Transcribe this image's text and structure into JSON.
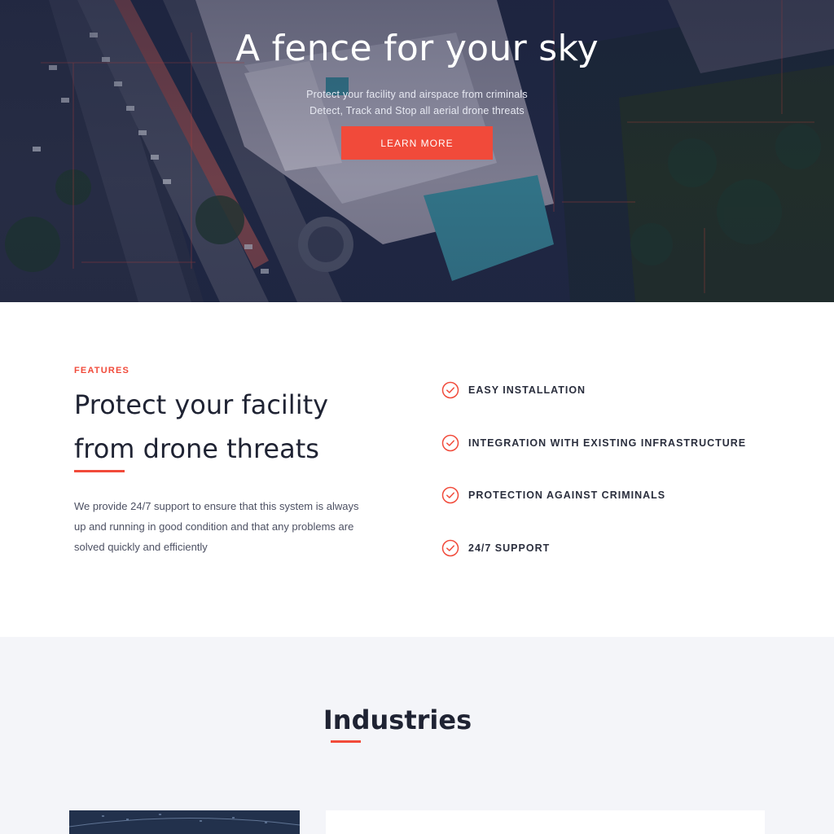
{
  "hero": {
    "title": "A fence for your sky",
    "subtitle_line1": "Protect your facility and airspace from criminals",
    "subtitle_line2": "Detect, Track and Stop all aerial drone threats",
    "cta_label": "LEARN MORE"
  },
  "features": {
    "eyebrow": "FEATURES",
    "title": "Protect your facility from drone threats",
    "description": "We provide 24/7 support to ensure that this system is always up and running in good condition and that any problems are solved quickly and efficiently",
    "items": [
      {
        "label": "EASY INSTALLATION",
        "icon": "check-circle-icon"
      },
      {
        "label": "INTEGRATION WITH EXISTING INFRASTRUCTURE",
        "icon": "check-circle-icon"
      },
      {
        "label": "PROTECTION AGAINST CRIMINALS",
        "icon": "check-circle-icon"
      },
      {
        "label": "24/7 SUPPORT",
        "icon": "check-circle-icon"
      }
    ]
  },
  "industries": {
    "title": "Industries"
  },
  "colors": {
    "accent": "#f14a3a",
    "hero_dark": "#1c2440",
    "text_dark": "#1f2333",
    "section_bg": "#f4f5f9"
  }
}
